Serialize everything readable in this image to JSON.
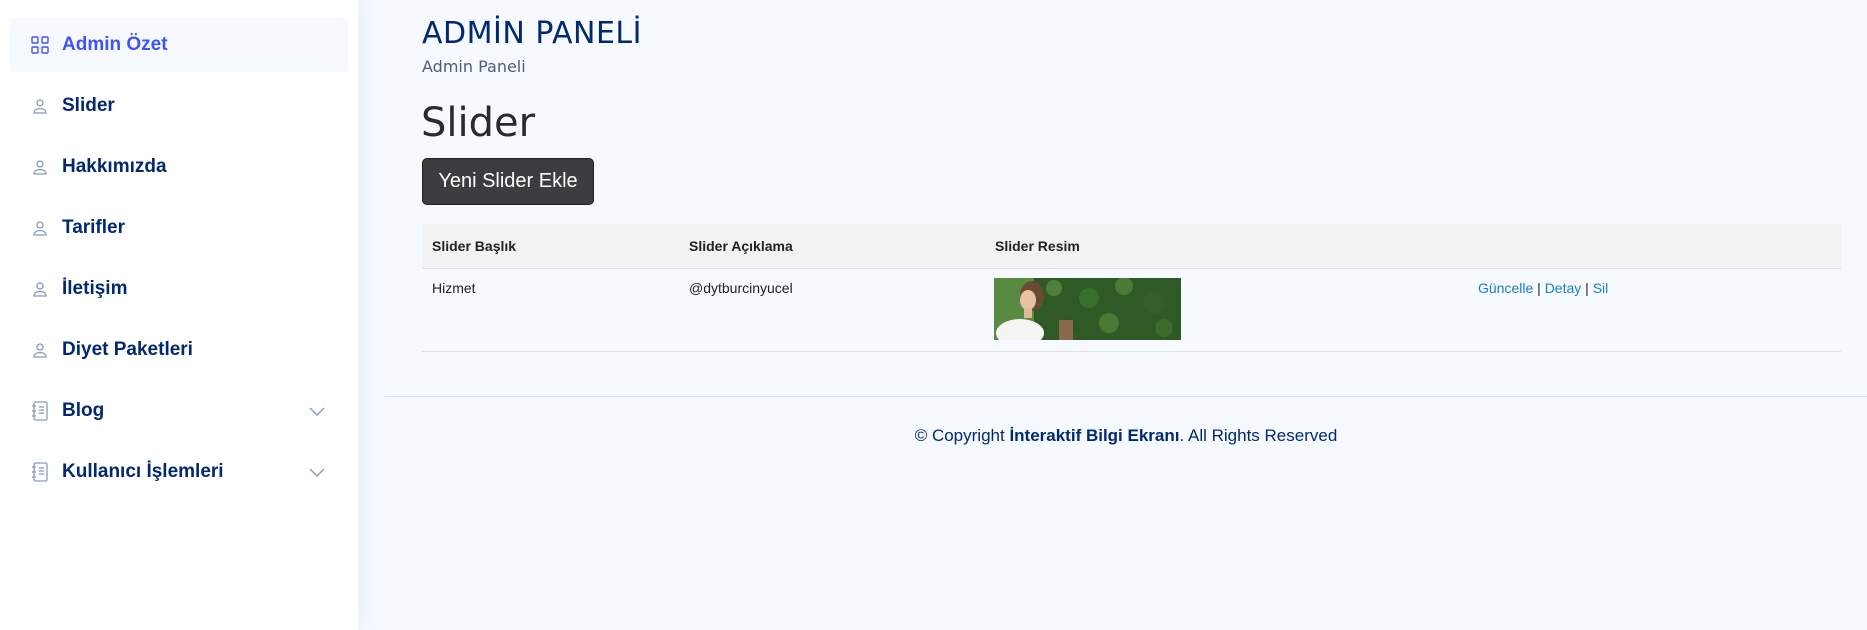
{
  "sidebar": {
    "items": [
      {
        "label": "Admin Özet",
        "icon": "grid-icon",
        "active": true
      },
      {
        "label": "Slider",
        "icon": "person-icon"
      },
      {
        "label": "Hakkımızda",
        "icon": "person-icon"
      },
      {
        "label": "Tarifler",
        "icon": "person-icon"
      },
      {
        "label": "İletişim",
        "icon": "person-icon"
      },
      {
        "label": "Diyet Paketleri",
        "icon": "person-icon"
      },
      {
        "label": "Blog",
        "icon": "journal-icon",
        "has_submenu": true
      },
      {
        "label": "Kullanıcı İşlemleri",
        "icon": "journal-icon",
        "has_submenu": true
      }
    ]
  },
  "header": {
    "title": "ADMİN PANELİ",
    "breadcrumb": "Admin Paneli"
  },
  "main": {
    "section_title": "Slider",
    "add_button": "Yeni Slider Ekle",
    "table": {
      "columns": [
        "Slider Başlık",
        "Slider Açıklama",
        "Slider Resim",
        ""
      ],
      "rows": [
        {
          "title": "Hizmet",
          "description": "@dytburcinyucel",
          "image": "slider-thumbnail",
          "actions": {
            "update": "Güncelle",
            "detail": "Detay",
            "delete": "Sil",
            "separator": "|"
          }
        }
      ]
    }
  },
  "footer": {
    "prefix": "© Copyright ",
    "brand": "İnteraktif Bilgi Ekranı",
    "suffix": ". All Rights Reserved"
  },
  "colors": {
    "brand": "#012970",
    "accent": "#4154f1",
    "link": "#1a7fc1",
    "button": "#3b3d3e"
  }
}
